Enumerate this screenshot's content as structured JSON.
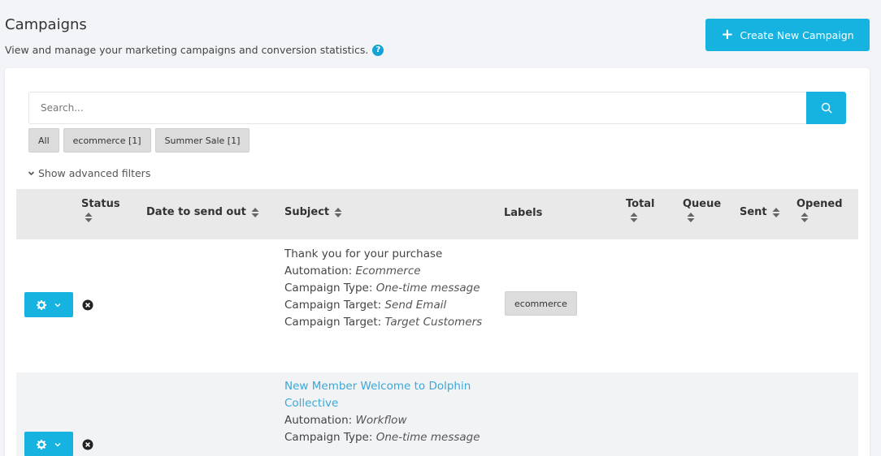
{
  "header": {
    "title": "Campaigns",
    "subtitle": "View and manage your marketing campaigns and conversion statistics.",
    "create_button": "Create New Campaign"
  },
  "search": {
    "placeholder": "Search...",
    "icon": "search-icon"
  },
  "filter_tags": [
    {
      "label": "All"
    },
    {
      "label": "ecommerce [1]"
    },
    {
      "label": "Summer Sale [1]"
    }
  ],
  "advanced_filters_label": "Show advanced filters",
  "table": {
    "columns": {
      "status": "Status",
      "date": "Date to send out",
      "subject": "Subject",
      "labels": "Labels",
      "total": "Total",
      "queue": "Queue",
      "sent": "Sent",
      "opened": "Opened"
    },
    "rows": [
      {
        "title": "Thank you for your purchase",
        "automation_label": "Automation:",
        "automation": "Ecommerce",
        "type_label": "Campaign Type:",
        "type": "One-time message",
        "target1_label": "Campaign Target:",
        "target1": "Send Email",
        "target2_label": "Campaign Target:",
        "target2": "Target Customers",
        "badge": "ecommerce"
      },
      {
        "title": "New Member Welcome to Dolphin Collective",
        "automation_label": "Automation:",
        "automation": "Workflow",
        "type_label": "Campaign Type:",
        "type": "One-time message"
      }
    ]
  },
  "colors": {
    "accent": "#17b3e0",
    "link": "#3aa8d8",
    "header_bg": "#e9e9e9"
  }
}
